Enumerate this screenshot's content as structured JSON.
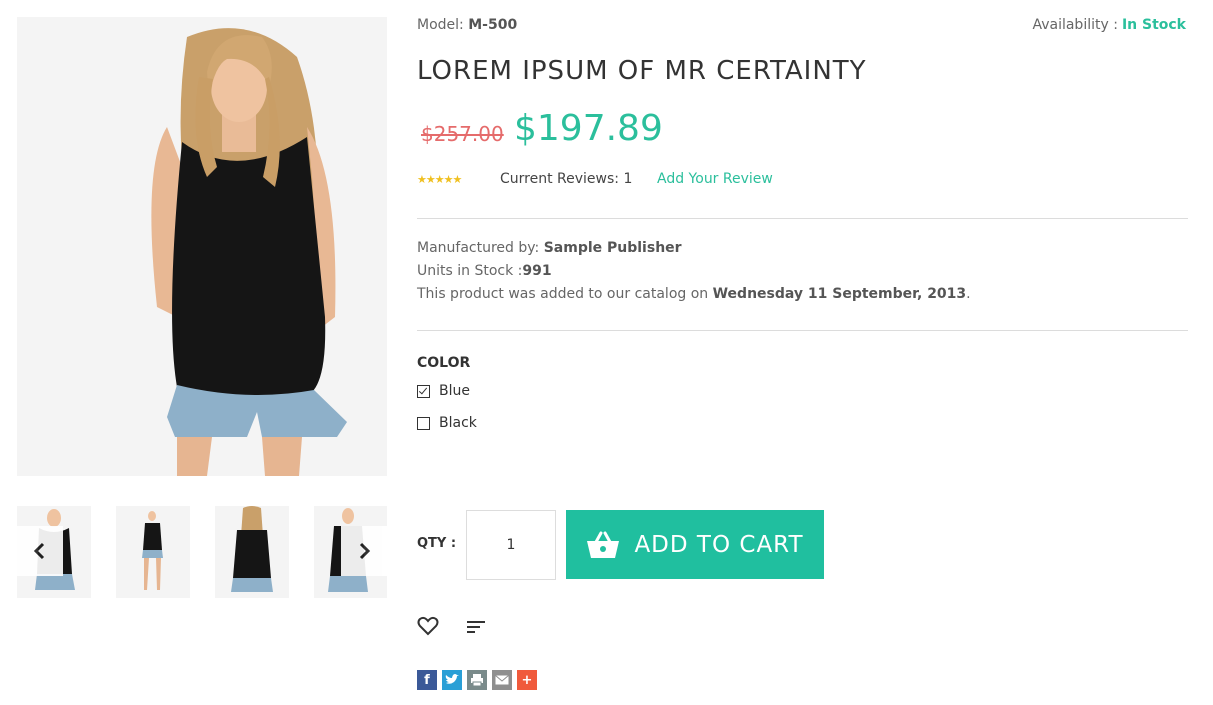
{
  "product": {
    "model_label": "Model:",
    "model_value": "M-500",
    "availability_label": "Availability :",
    "availability_value": "In Stock",
    "title": "LOREM IPSUM OF MR CERTAINTY",
    "price_old": "$257.00",
    "price_new": "$197.89",
    "rating": "5 of 5 stars",
    "reviews_text": "Current Reviews: 1",
    "add_review": "Add Your Review",
    "manufacturer_label": "Manufactured by:",
    "manufacturer_value": "Sample Publisher",
    "stock_label": "Units in Stock :",
    "stock_value": "991",
    "added_prefix": "This product was added to our catalog on",
    "added_date": "Wednesday 11 September, 2013",
    "added_suffix": "."
  },
  "options": {
    "heading": "COLOR",
    "items": [
      {
        "label": "Blue",
        "checked": true
      },
      {
        "label": "Black",
        "checked": false
      }
    ]
  },
  "purchase": {
    "qty_label": "QTY :",
    "qty_value": "1",
    "add_to_cart": "ADD TO CART"
  },
  "gallery": {
    "prev_icon": "chevron-left-icon",
    "next_icon": "chevron-right-icon",
    "thumbs": [
      "front",
      "full-body",
      "back",
      "side"
    ]
  },
  "actions": {
    "wishlist_icon": "heart-icon",
    "compare_icon": "compare-list-icon"
  },
  "share": [
    {
      "icon": "facebook-icon",
      "glyph": "f",
      "color": "#3b5998"
    },
    {
      "icon": "twitter-icon",
      "glyph": "t",
      "color": "#2a9fd6"
    },
    {
      "icon": "print-icon",
      "glyph": "",
      "color": "#7a8b8b"
    },
    {
      "icon": "email-icon",
      "glyph": "",
      "color": "#8f8f8f"
    },
    {
      "icon": "more-share-icon",
      "glyph": "+",
      "color": "#f05a3c"
    }
  ],
  "colors": {
    "accent": "#20bf9f",
    "old_price": "#e56b6b",
    "star": "#f0c020"
  }
}
